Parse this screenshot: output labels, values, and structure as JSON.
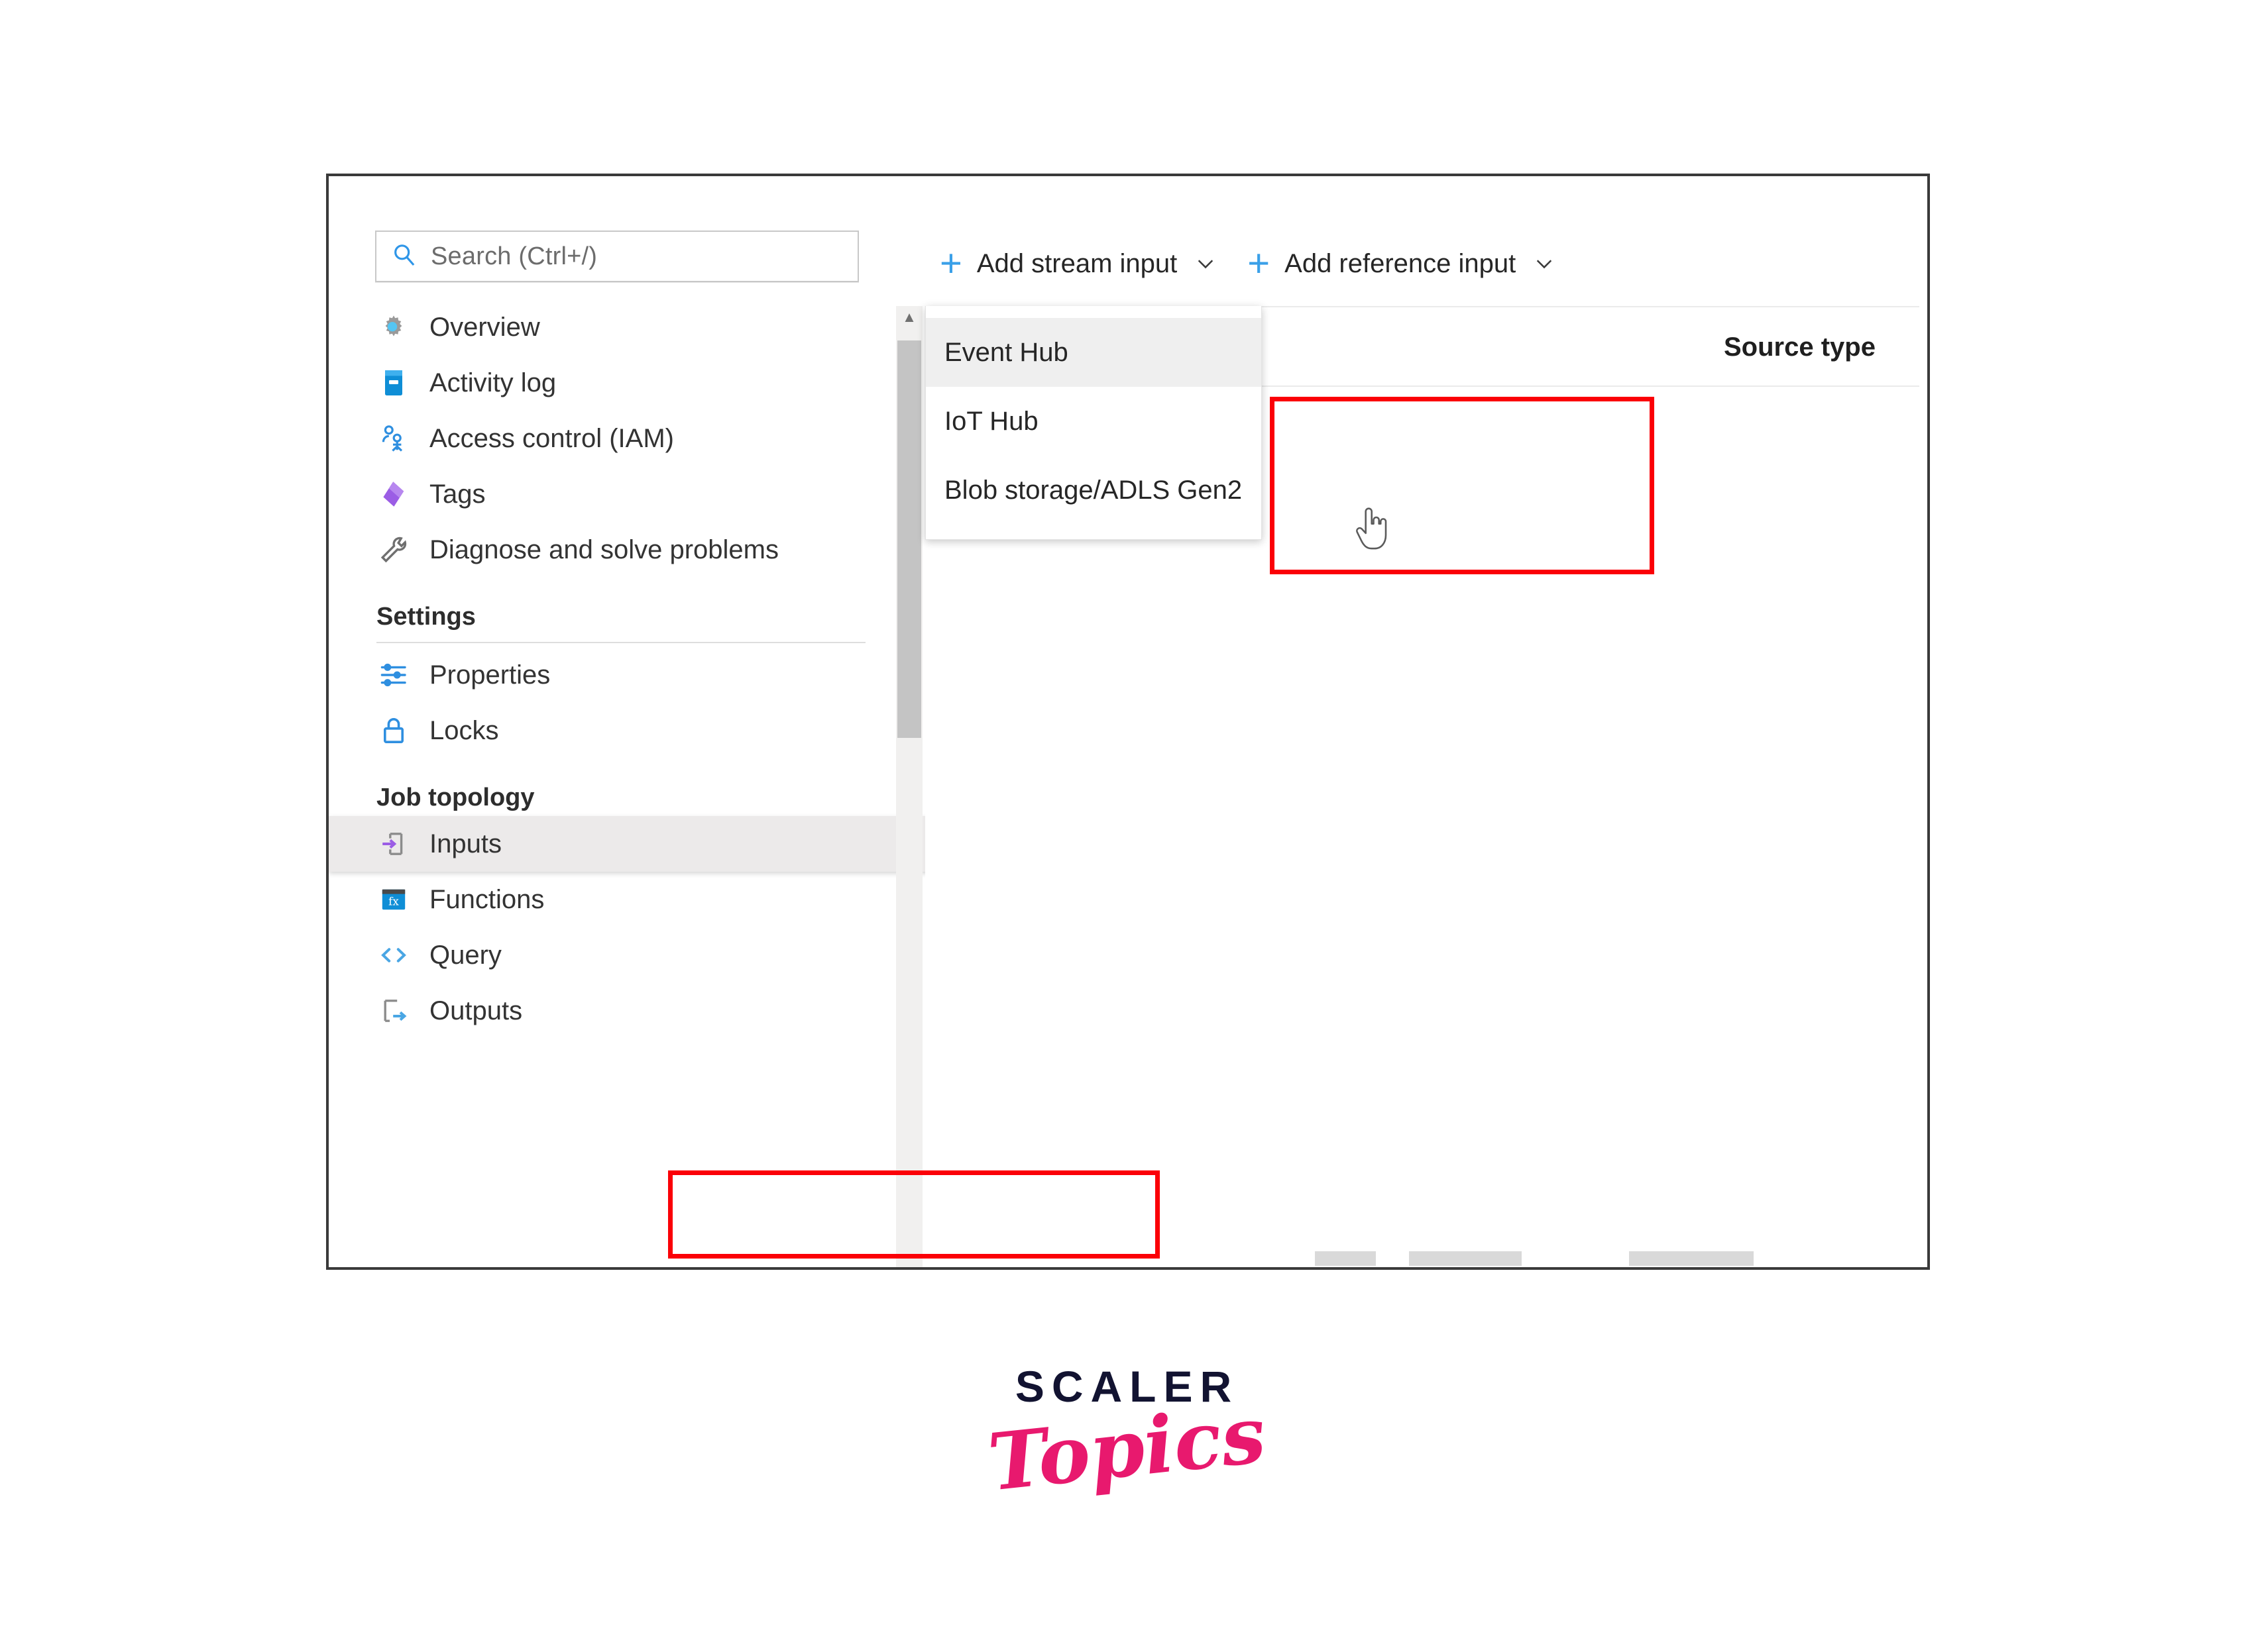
{
  "colors": {
    "accent_blue": "#3aa0e8",
    "annotation_red": "#fb0007",
    "frame_border": "#3a3a3a",
    "selected_row": "#eceaea",
    "logo_dark": "#121331",
    "logo_pink": "#e8196e"
  },
  "search": {
    "placeholder": "Search (Ctrl+/)",
    "icon": "search-icon"
  },
  "collapse": {
    "glyph": "«"
  },
  "sidebar": {
    "items": [
      {
        "label": "Overview",
        "icon": "overview-gear-icon",
        "type": "item"
      },
      {
        "label": "Activity log",
        "icon": "activity-log-icon",
        "type": "item"
      },
      {
        "label": "Access control (IAM)",
        "icon": "access-control-icon",
        "type": "item"
      },
      {
        "label": "Tags",
        "icon": "tag-icon",
        "type": "item"
      },
      {
        "label": "Diagnose and solve problems",
        "icon": "wrench-icon",
        "type": "item"
      }
    ],
    "sections": [
      {
        "title": "Settings",
        "items": [
          {
            "label": "Properties",
            "icon": "sliders-icon"
          },
          {
            "label": "Locks",
            "icon": "lock-icon"
          }
        ]
      },
      {
        "title": "Job topology",
        "items": [
          {
            "label": "Inputs",
            "icon": "inputs-icon",
            "selected": true
          },
          {
            "label": "Functions",
            "icon": "functions-icon"
          },
          {
            "label": "Query",
            "icon": "code-brackets-icon"
          },
          {
            "label": "Outputs",
            "icon": "outputs-icon"
          }
        ]
      }
    ]
  },
  "toolbar": {
    "add_stream_input": "Add stream input",
    "add_reference_input": "Add reference input",
    "plus_glyph": "+",
    "caret_icon": "chevron-down-icon"
  },
  "table": {
    "columns": [
      "Source type"
    ]
  },
  "dropdown": {
    "items": [
      {
        "label": "Event Hub",
        "active": true
      },
      {
        "label": "IoT Hub",
        "active": false
      },
      {
        "label": "Blob storage/ADLS Gen2",
        "active": false
      }
    ]
  },
  "cursor": {
    "icon": "pointing-hand-cursor"
  },
  "logo": {
    "line1": "SCALER",
    "line2": "Topics"
  }
}
